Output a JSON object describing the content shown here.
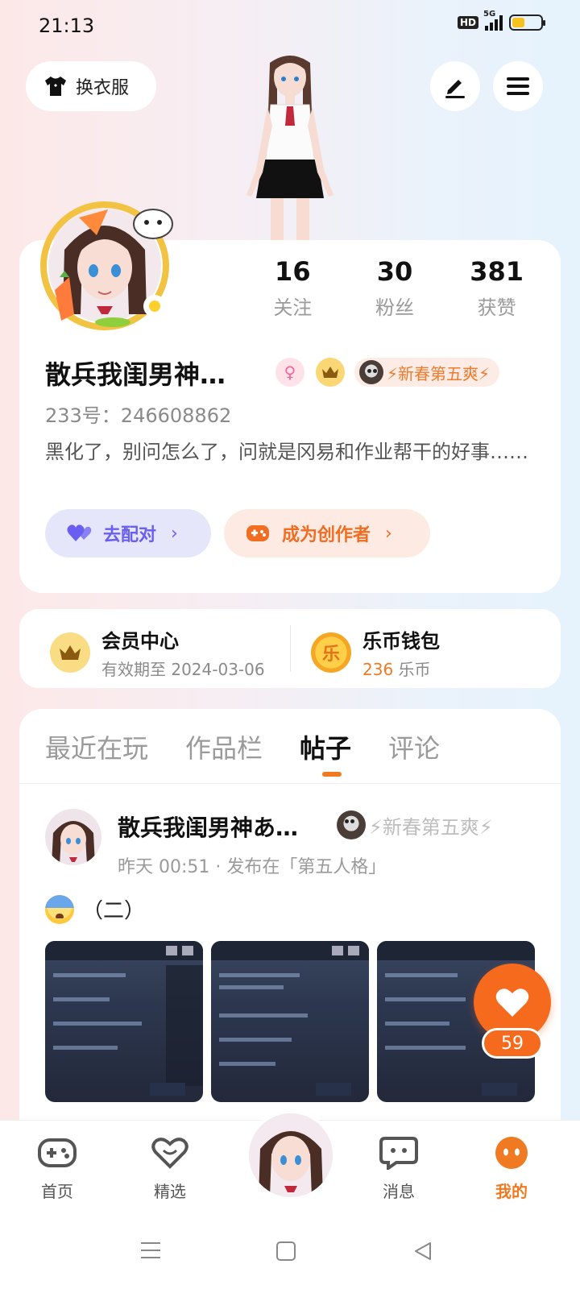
{
  "status_bar": {
    "time": "21:13",
    "hd": "HD",
    "network": "5G"
  },
  "top": {
    "outfit_label": "换衣服"
  },
  "profile": {
    "stats": [
      {
        "num": "16",
        "label": "关注"
      },
      {
        "num": "30",
        "label": "粉丝"
      },
      {
        "num": "381",
        "label": "获赞"
      }
    ],
    "username": "散兵我闺男神…",
    "event_tag": "⚡新春第五爽⚡",
    "uid": "233号：246608862",
    "bio": "黑化了，别问怎么了，问就是冈易和作业帮干的好事……",
    "match_label": "去配对",
    "creator_label": "成为创作者"
  },
  "vip": {
    "member_title": "会员中心",
    "member_sub": "有效期至 2024-03-06",
    "wallet_title": "乐币钱包",
    "wallet_amount": "236",
    "wallet_unit": "乐币",
    "coin_glyph": "乐"
  },
  "tabs": [
    "最近在玩",
    "作品栏",
    "帖子",
    "评论"
  ],
  "active_tab": "帖子",
  "post": {
    "author": "散兵我闺男神あ…",
    "tag": "⚡新春第五爽⚡",
    "meta": "昨天 00:51 · 发布在「第五人格」",
    "text": "（二）",
    "like_count": "59"
  },
  "nav": {
    "items": [
      "首页",
      "精选",
      "消息",
      "我的"
    ],
    "active": "我的"
  },
  "colors": {
    "accent": "#f07a22",
    "match": "#6a5ef2"
  }
}
